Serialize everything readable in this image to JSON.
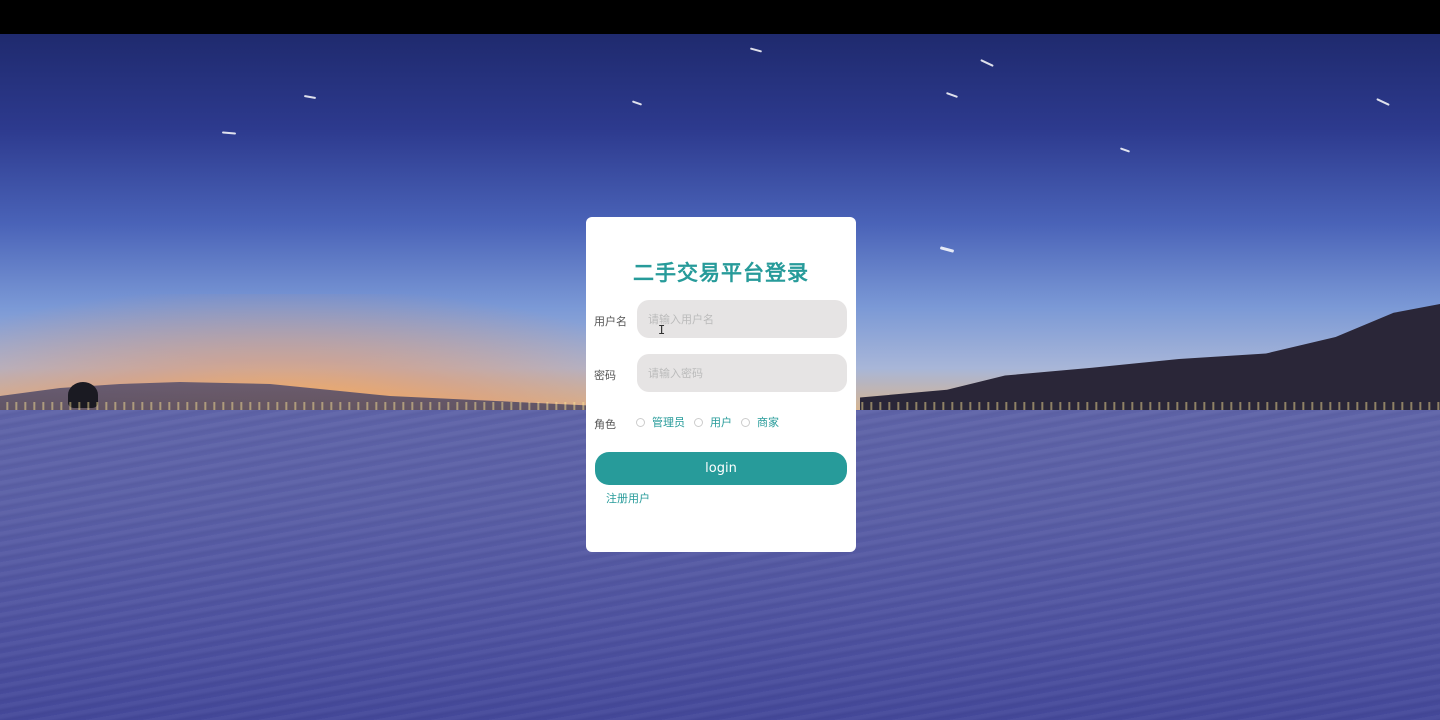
{
  "login_card": {
    "title": "二手交易平台登录",
    "username": {
      "label": "用户名",
      "placeholder": "请输入用户名",
      "value": ""
    },
    "password": {
      "label": "密码",
      "placeholder": "请输入密码",
      "value": ""
    },
    "role": {
      "label": "角色",
      "options": [
        "管理员",
        "用户",
        "商家"
      ],
      "selected": null
    },
    "login_button": "login",
    "register_link": "注册用户"
  },
  "colors": {
    "accent": "#279b9a",
    "input_bg": "#e6e4e4",
    "card_bg": "#ffffff",
    "top_bar": "#000000"
  },
  "icons": {
    "cursor": "i-beam-cursor-icon"
  }
}
